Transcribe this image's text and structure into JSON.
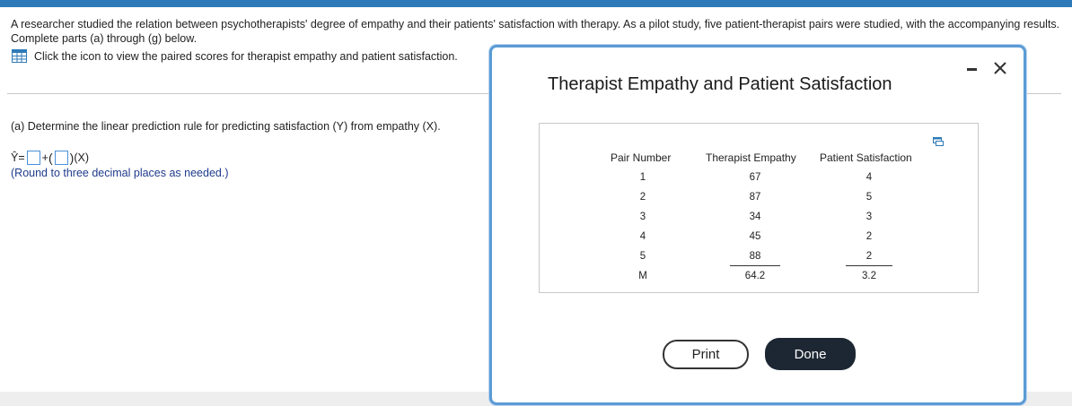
{
  "question": {
    "text": "A researcher studied the relation between psychotherapists' degree of empathy and their patients' satisfaction with therapy. As a pilot study, five patient-therapist pairs were studied, with the accompanying results. Complete parts (a) through (g) below.",
    "help_link": "Click the icon to view the paired scores for therapist empathy and patient satisfaction."
  },
  "part_a": {
    "label": "(a) Determine the linear prediction rule for predicting satisfaction (Y) from empathy (X).",
    "yhat": "Ŷ",
    "equals": "=",
    "plus": "+",
    "open_paren": "(",
    "close_paren": ")",
    "x_term": "(X)",
    "intercept_value": "",
    "slope_value": "",
    "round_note": "(Round to three decimal places as needed.)"
  },
  "modal": {
    "title": "Therapist Empathy and Patient Satisfaction",
    "table": {
      "headers": [
        "Pair Number",
        "Therapist Empathy",
        "Patient Satisfaction"
      ],
      "rows": [
        [
          "1",
          "67",
          "4"
        ],
        [
          "2",
          "87",
          "5"
        ],
        [
          "3",
          "34",
          "3"
        ],
        [
          "4",
          "45",
          "2"
        ],
        [
          "5",
          "88",
          "2"
        ]
      ],
      "mean_row": [
        "M",
        "64.2",
        "3.2"
      ]
    },
    "print_label": "Print",
    "done_label": "Done"
  },
  "colors": {
    "accent": "#2e7ab8",
    "modal_border": "#5b9bd5",
    "note_text": "#1f3b8c",
    "done_button": "#1d2733"
  },
  "icons": [
    "grid-table-icon",
    "minimize-icon",
    "close-icon",
    "popout-icon"
  ]
}
